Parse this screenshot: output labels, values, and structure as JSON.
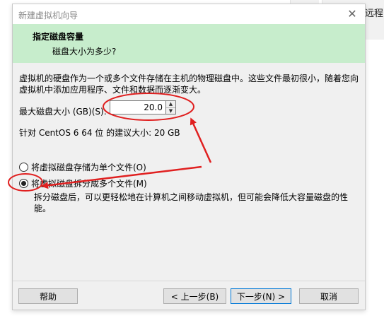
{
  "background": {
    "right_text": "远程"
  },
  "dialog": {
    "title": "新建虚拟机向导",
    "close_glyph": "✕",
    "header": {
      "title": "指定磁盘容量",
      "subtitle": "磁盘大小为多少?"
    },
    "description": "虚拟机的硬盘作为一个或多个文件存储在主机的物理磁盘中。这些文件最初很小，随着您向虚拟机中添加应用程序、文件和数据而逐渐变大。",
    "max_disk_label": "最大磁盘大小 (GB)(S):",
    "max_disk_value": "20.0",
    "recommended": "针对 CentOS 6 64 位 的建议大小: 20 GB",
    "options": {
      "single_file": "将虚拟磁盘存储为单个文件(O)",
      "split_files": "将虚拟磁盘拆分成多个文件(M)",
      "split_desc": "拆分磁盘后，可以更轻松地在计算机之间移动虚拟机，但可能会降低大容量磁盘的性能。",
      "selected": "split_files"
    },
    "buttons": {
      "help": "帮助",
      "back": "< 上一步(B)",
      "next": "下一步(N) >",
      "cancel": "取消"
    }
  },
  "colors": {
    "header_band": "#c7edcc",
    "dialog_bg": "#f0f0f0",
    "annotation": "#e02020",
    "default_button_border": "#0078d7"
  }
}
